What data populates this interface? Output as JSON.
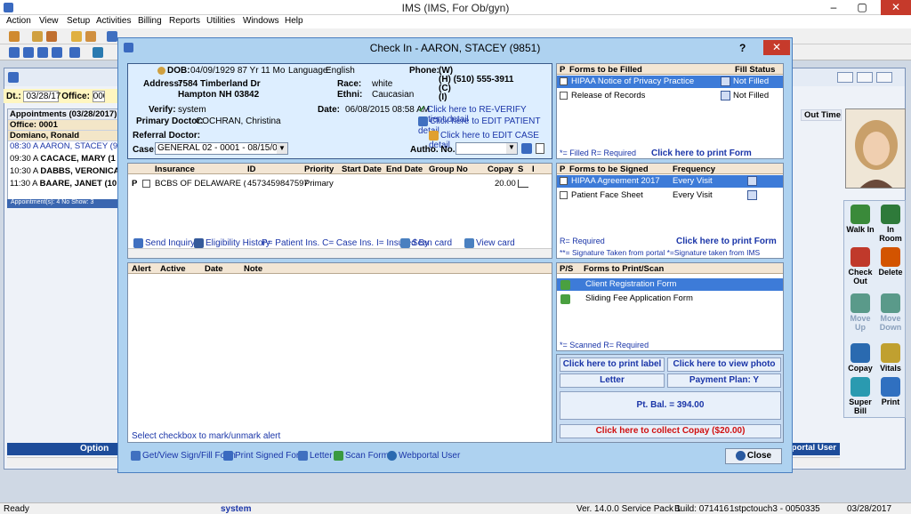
{
  "app": {
    "title": "IMS (IMS, For Ob/gyn)"
  },
  "window_controls": [
    "–",
    "▢",
    "✕"
  ],
  "menu": [
    "Action",
    "View",
    "Setup",
    "Activities",
    "Billing",
    "Reports",
    "Utilities",
    "Windows",
    "Help"
  ],
  "schedule": {
    "dt_label": "Dt.:",
    "date": "03/28/17",
    "office_label": "Office:",
    "office_value": "0001",
    "appt_header": "Appointments (03/28/2017)",
    "office_row": "Office: 0001",
    "provider_row": "Domiano, Ronald",
    "rows": [
      {
        "time": "08:30 A",
        "name": "AARON, STACEY (98"
      },
      {
        "time": "09:30 A",
        "name": "CACACE, MARY  (1"
      },
      {
        "time": "10:30 A",
        "name": "DABBS, VERONICA"
      },
      {
        "time": "11:30 A",
        "name": "BAARE, JANET  (10"
      }
    ],
    "footer": "Appointment(s): 4   No Show: 3",
    "option_label": "Option",
    "out_time_header": "Out Time",
    "portal_user": "oportal User"
  },
  "side_buttons": [
    {
      "label": "Walk In",
      "color": "#3a8a3a"
    },
    {
      "label": "In Room",
      "color": "#2e7a3a"
    },
    {
      "label": "Check Out",
      "color": "#c0392b"
    },
    {
      "label": "Delete",
      "color": "#d35400"
    },
    {
      "label": "Move Up",
      "color": "#5a9a8a"
    },
    {
      "label": "Move Down",
      "color": "#5a9a8a"
    },
    {
      "label": "Copay",
      "color": "#2a6ab0"
    },
    {
      "label": "Vitals",
      "color": "#c0a030"
    },
    {
      "label": "Super Bill",
      "color": "#2a9ab0"
    },
    {
      "label": "Print",
      "color": "#3070c0"
    }
  ],
  "status_bar": {
    "ready": "Ready",
    "user": "system",
    "version": "Ver. 14.0.0 Service Pack 1",
    "build": "Build: 071416",
    "server": "1stpctouch3 - 0050335",
    "date": "03/28/2017"
  },
  "dialog": {
    "title": "Check In - AARON, STACEY  (9851)",
    "help": "?",
    "close": "✕",
    "patient": {
      "dob_label": "DOB:",
      "dob": "04/09/1929  87 Yr 11 Mo",
      "language_label": "Language:",
      "language": "English",
      "phone_label": "Phone:",
      "phone_w": "(W)",
      "phone_h": "(H)  (510)  555-3911",
      "phone_c": "(C)",
      "phone_i": "(I)",
      "address_label": "Address:",
      "address1": "7584 Timberland Dr",
      "address2": "Hampton  NH  03842",
      "race_label": "Race:",
      "race": "white",
      "ethni_label": "Ethni:",
      "ethni": "Caucasian",
      "verify_label": "Verify:",
      "verify": "system",
      "date_label": "Date:",
      "date": "06/08/2015 08:58 AM",
      "reverify_link": "Click here to RE-VERIFY patient detail",
      "primary_doctor_label": "Primary Doctor:",
      "primary_doctor": "COCHRAN, Christina",
      "edit_patient_link": "Click here to EDIT PATIENT detail",
      "referral_doctor_label": "Referral Doctor:",
      "edit_case_link": "Click here to EDIT CASE detail",
      "case_label": "Case:",
      "case_value": "GENERAL 02  -  0001 - 08/15/08",
      "autho_label": "Autho. No.:"
    },
    "insurance": {
      "headers": [
        "Insurance",
        "ID",
        "Priority",
        "Start Date",
        "End Date",
        "Group No",
        "Copay",
        "S",
        "I"
      ],
      "rows": [
        {
          "p": "P",
          "insurance": "BCBS OF DELAWARE  (3",
          "id": "4573459847597",
          "priority": "Primary",
          "copay": "20.00"
        }
      ],
      "links": {
        "send_inquiry": "Send Inquiry",
        "eligibility": "Eligibility History",
        "legend": "P= Patient Ins. C= Case Ins.  I= Insured By",
        "scan_card": "Scan card",
        "view_card": "View card"
      }
    },
    "alerts": {
      "headers": [
        "Alert",
        "Active",
        "Date",
        "Note"
      ],
      "footer": "Select checkbox to mark/unmark alert"
    },
    "forms_to_fill": {
      "headers": [
        "P",
        "Forms to be Filled",
        "Fill Status"
      ],
      "rows": [
        {
          "name": "HIPAA Notice of Privacy Practice",
          "status": "Not Filled"
        },
        {
          "name": "Release of Records",
          "status": "Not Filled"
        }
      ],
      "legend": "*= Filled  R= Required",
      "print_link": "Click here to print Form"
    },
    "forms_to_sign": {
      "headers": [
        "P",
        "Forms to be Signed",
        "Frequency"
      ],
      "rows": [
        {
          "name": "HIPAA Agreement 2017",
          "frequency": "Every Visit"
        },
        {
          "name": "Patient Face Sheet",
          "frequency": "Every Visit"
        }
      ],
      "legend1": "R= Required",
      "print_link": "Click here to print Form",
      "legend2": "**= Signature Taken from portal  *=Signature taken from IMS"
    },
    "forms_print_scan": {
      "headers": [
        "P/S",
        "Forms to Print/Scan"
      ],
      "rows": [
        "Client Registration Form",
        "Sliding Fee Application Form"
      ],
      "legend": "*= Scanned   R= Required"
    },
    "actions": {
      "print_label": "Click here to print label",
      "view_photo": "Click here to view photo",
      "letter": "Letter",
      "payment_plan": "Payment Plan: Y",
      "balance": "Pt. Bal. = 394.00",
      "collect_copay": "Click here to collect Copay ($20.00)"
    },
    "bottom_bar": {
      "get_view": "Get/View Sign/Fill Form",
      "print_signed": "Print Signed Form",
      "letter": "Letter",
      "scan_form": "Scan Form",
      "webportal": "Webportal User",
      "close": "Close"
    }
  }
}
